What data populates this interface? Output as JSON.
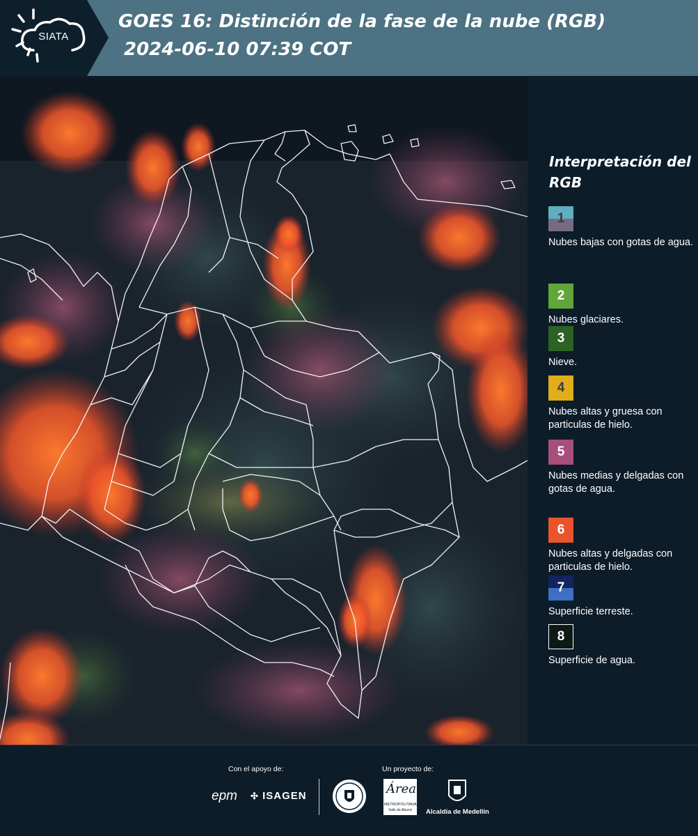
{
  "header": {
    "logo_text": "SIATA",
    "title": "GOES 16: Distinción de la fase de la nube (RGB)",
    "timestamp": "2024-06-10 07:39 COT"
  },
  "legend": {
    "title": "Interpretación del RGB",
    "items": [
      {
        "number": "1",
        "label": "Nubes bajas con gotas de agua.",
        "color_top": "#5eb0c0",
        "color_bottom": "#776b84",
        "text_color": "#3c3c3c"
      },
      {
        "number": "2",
        "label": "Nubes glaciares.",
        "color_top": "#60a638",
        "color_bottom": "#60a638",
        "text_color": "#ffffff"
      },
      {
        "number": "3",
        "label": "Nieve.",
        "color_top": "#2c6224",
        "color_bottom": "#2c6224",
        "text_color": "#ffffff"
      },
      {
        "number": "4",
        "label": "Nubes altas y gruesa con particulas de hielo.",
        "color_top": "#e1ad1a",
        "color_bottom": "#e1ad1a",
        "text_color": "#3c3c3c"
      },
      {
        "number": "5",
        "label": "Nubes medias y delgadas con gotas de agua.",
        "color_top": "#a84e7b",
        "color_bottom": "#a84e7b",
        "text_color": "#ffffff"
      },
      {
        "number": "6",
        "label": "Nubes altas y delgadas con particulas de hielo.",
        "color_top": "#e9542c",
        "color_bottom": "#e9542c",
        "text_color": "#ffffff"
      },
      {
        "number": "7",
        "label": "Superficie terreste.",
        "color_top": "#13235c",
        "color_bottom": "#3e6fc2",
        "text_color": "#ffffff"
      },
      {
        "number": "8",
        "label": "Superficie de agua.",
        "color_top": "#0c1a16",
        "color_bottom": "#0c1a16",
        "text_color": "#ffffff"
      }
    ]
  },
  "footer": {
    "support_label": "Con el apoyo de:",
    "project_label": "Un proyecto de:",
    "sponsors": [
      "epm",
      "ISAGEN"
    ],
    "partners": {
      "metro_big": "Área",
      "metro_name": "METROPOLITANA",
      "metro_sub": "Valle de Aburrá",
      "alcaldia": "Alcaldía de Medellín"
    }
  }
}
